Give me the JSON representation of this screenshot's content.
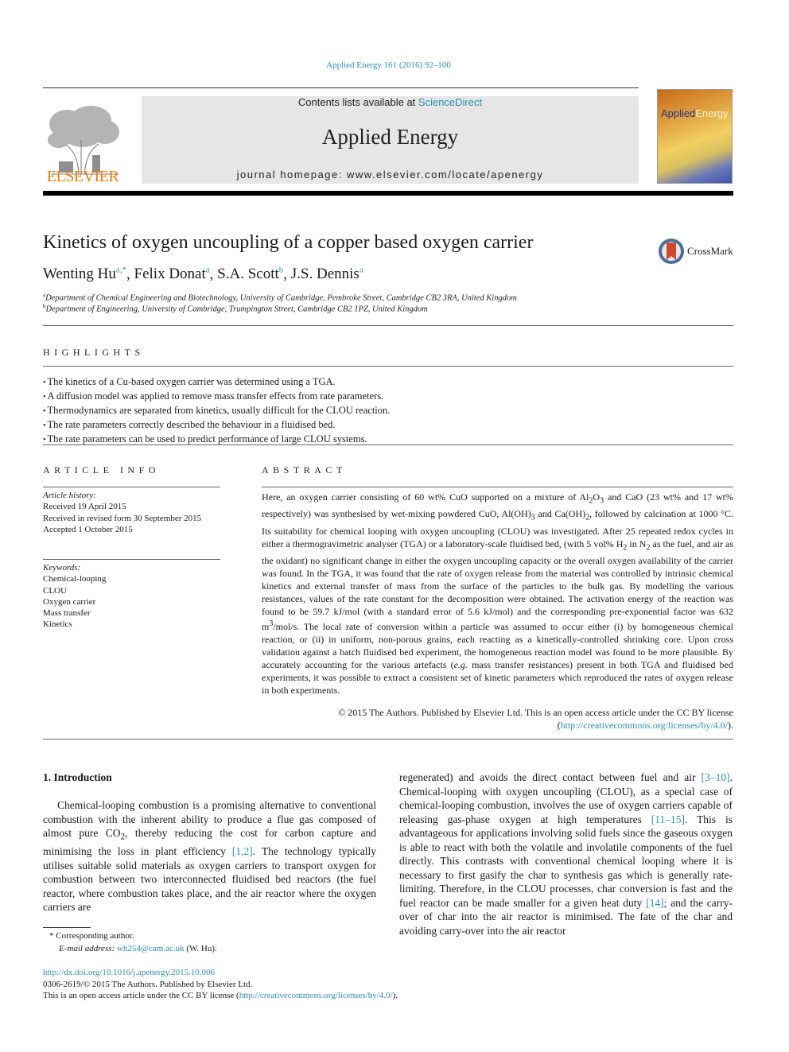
{
  "header": {
    "journal_ref": "Applied Energy 161 (2016) 92–100",
    "contents_prefix": "Contents lists available at ",
    "contents_link": "ScienceDirect",
    "journal_title": "Applied Energy",
    "homepage": "journal homepage: www.elsevier.com/locate/apenergy",
    "publisher_logo": "ELSEVIER",
    "cover_title_a": "Applied",
    "cover_title_b": "Energy",
    "crossmark_label": "CrossMark"
  },
  "article": {
    "title": "Kinetics of oxygen uncoupling of a copper based oxygen carrier",
    "authors": [
      {
        "name": "Wenting Hu",
        "sup": "a,*",
        "sep": ", "
      },
      {
        "name": "Felix Donat",
        "sup": "a",
        "sep": ", "
      },
      {
        "name": "S.A. Scott",
        "sup": "b",
        "sep": ", "
      },
      {
        "name": "J.S. Dennis",
        "sup": "a",
        "sep": ""
      }
    ],
    "affiliations": [
      {
        "mark": "a",
        "text": "Department of Chemical Engineering and Biotechnology, University of Cambridge, Pembroke Street, Cambridge CB2 3RA, United Kingdom"
      },
      {
        "mark": "b",
        "text": "Department of Engineering, University of Cambridge, Trumpington Street, Cambridge CB2 1PZ, United Kingdom"
      }
    ]
  },
  "highlights": {
    "heading": "HIGHLIGHTS",
    "items": [
      "The kinetics of a Cu-based oxygen carrier was determined using a TGA.",
      "A diffusion model was applied to remove mass transfer effects from rate parameters.",
      "Thermodynamics are separated from kinetics, usually difficult for the CLOU reaction.",
      "The rate parameters correctly described the behaviour in a fluidised bed.",
      "The rate parameters can be used to predict performance of large CLOU systems."
    ]
  },
  "article_info": {
    "heading": "ARTICLE INFO",
    "history_label": "Article history:",
    "history": [
      "Received 19 April 2015",
      "Received in revised form 30 September 2015",
      "Accepted 1 October 2015"
    ],
    "keywords_label": "Keywords:",
    "keywords": [
      "Chemical-looping",
      "CLOU",
      "Oxygen carrier",
      "Mass transfer",
      "Kinetics"
    ]
  },
  "abstract": {
    "heading": "ABSTRACT",
    "p1": "Here, an oxygen carrier consisting of 60 wt% CuO supported on a mixture of Al",
    "p2": "O",
    "p3": " and CaO (23 wt% and 17 wt% respectively) was synthesised by wet-mixing powdered CuO, Al(OH)",
    "p4": " and Ca(OH)",
    "p5": ", followed by calcination at 1000 °C. Its suitability for chemical looping with oxygen uncoupling (CLOU) was investigated. After 25 repeated redox cycles in either a thermogravimetric analyser (TGA) or a laboratory-scale fluidised bed, (with 5 vol% H",
    "p6": " in N",
    "p7": " as the fuel, and air as the oxidant) no significant change in either the oxygen uncoupling capacity or the overall oxygen availability of the carrier was found. In the TGA, it was found that the rate of oxygen release from the material was controlled by intrinsic chemical kinetics and external transfer of mass from the surface of the particles to the bulk gas. By modelling the various resistances, values of the rate constant for the decomposition were obtained. The activation energy of the reaction was found to be 59.7 kJ/mol (with a standard error of 5.6 kJ/mol) and the corresponding pre-exponential factor was 632 m",
    "p8": "/mol/s. The local rate of conversion within a particle was assumed to occur either (i) by homogeneous chemical reaction, or (ii) in uniform, non-porous grains, each reacting as a kinetically-controlled shrinking core. Upon cross validation against a batch fluidised bed experiment, the homogeneous reaction model was found to be more plausible. By accurately accounting for the various artefacts (",
    "eg": "e.g.",
    "p9": " mass transfer resistances) present in both TGA and fluidised bed experiments, it was possible to extract a consistent set of kinetic parameters which reproduced the rates of oxygen release in both experiments.",
    "sub2": "2",
    "sub3": "3",
    "sup3": "3",
    "copyright_text": "© 2015 The Authors. Published by Elsevier Ltd. This is an open access article under the CC BY license (",
    "copyright_link": "http://creativecommons.org/licenses/by/4.0/",
    "copyright_end": ")."
  },
  "intro": {
    "heading": "1. Introduction",
    "left_a": "Chemical-looping combustion is a promising alternative to conventional combustion with the inherent ability to produce a flue gas composed of almost pure CO",
    "left_b": ", thereby reducing the cost for carbon capture and minimising the loss in plant efficiency ",
    "ref_1_2": "[1,2]",
    "left_c": ". The technology typically utilises suitable solid materials as oxygen carriers to transport oxygen for combustion between two interconnected fluidised bed reactors (the fuel reactor, where combustion takes place, and the air reactor where the oxygen carriers are",
    "right_a": "regenerated) and avoids the direct contact between fuel and air ",
    "ref_3_10": "[3–10]",
    "right_b": ". Chemical-looping with oxygen uncoupling (CLOU), as a special case of chemical-looping combustion, involves the use of oxygen carriers capable of releasing gas-phase oxygen at high temperatures ",
    "ref_11_15": "[11–15]",
    "right_c": ". This is advantageous for applications involving solid fuels since the gaseous oxygen is able to react with both the volatile and involatile components of the fuel directly. This contrasts with conventional chemical looping where it is necessary to first gasify the char to synthesis gas which is generally rate-limiting. Therefore, in the CLOU processes, char conversion is fast and the fuel reactor can be made smaller for a given heat duty ",
    "ref_14": "[14]",
    "right_d": "; and the carry-over of char into the air reactor is minimised. The fate of the char and avoiding carry-over into the air reactor"
  },
  "footnotes": {
    "corresponding": "* Corresponding author.",
    "email_label": "E-mail address: ",
    "email": "wh254@cam.ac.uk",
    "email_suffix": " (W. Hu).",
    "doi": "http://dx.doi.org/10.1016/j.apenergy.2015.10.006",
    "issn_line": "0306-2619/© 2015 The Authors. Published by Elsevier Ltd.",
    "oa_prefix": "This is an open access article under the CC BY license (",
    "oa_link": "http://creativecommons.org/licenses/by/4.0/",
    "oa_suffix": ")."
  },
  "colors": {
    "link": "#2a8fb8",
    "elsevier_orange": "#f07d00",
    "masthead_bg": "#e6e6e6"
  }
}
